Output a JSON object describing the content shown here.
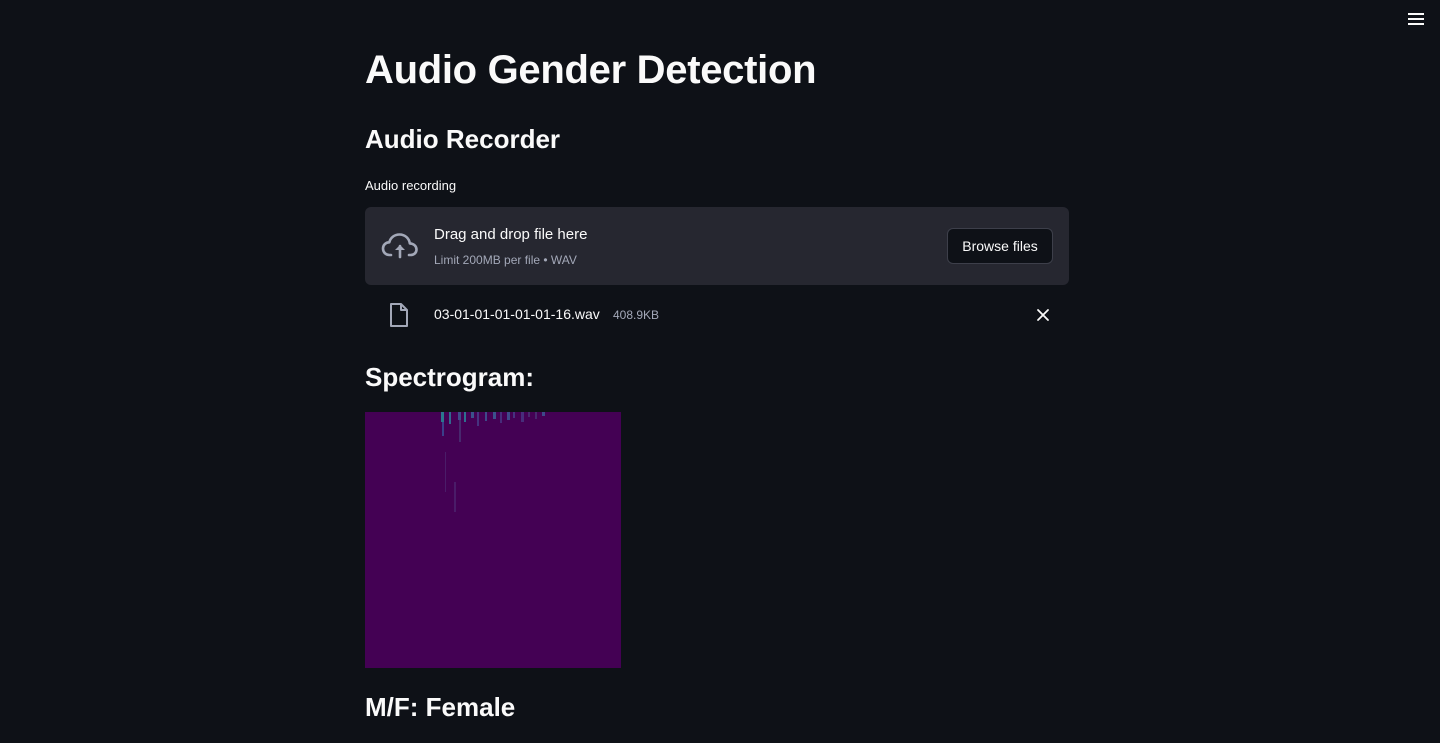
{
  "app": {
    "title": "Audio Gender Detection"
  },
  "recorder": {
    "heading": "Audio Recorder",
    "uploader_label": "Audio recording",
    "drop_text": "Drag and drop file here",
    "limit_text": "Limit 200MB per file • WAV",
    "browse_label": "Browse files",
    "icon": "cloud-upload-icon"
  },
  "uploaded_file": {
    "name": "03-01-01-01-01-01-16.wav",
    "size": "408.9KB",
    "icon": "file-icon"
  },
  "spectrogram": {
    "heading": "Spectrogram:",
    "background_color": "#440154"
  },
  "result": {
    "text": "M/F: Female"
  },
  "colors": {
    "background": "#0e1117",
    "panel": "#262730",
    "text": "#fafafa",
    "muted": "#a3a8b8"
  }
}
